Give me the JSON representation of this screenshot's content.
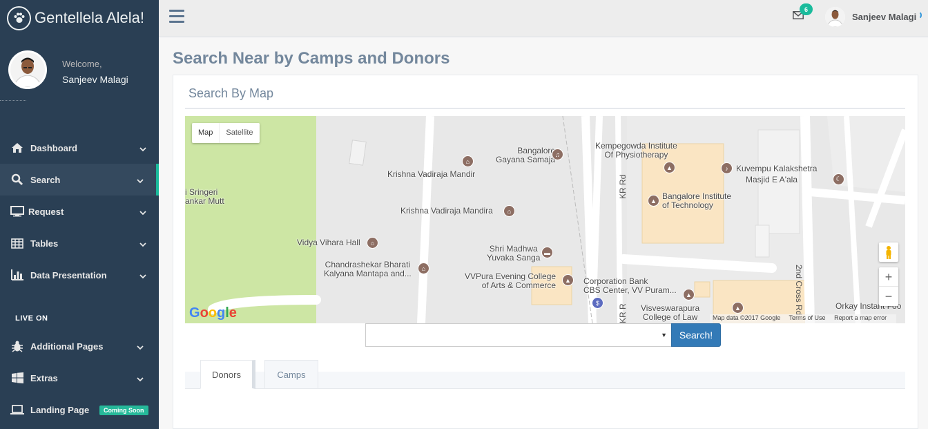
{
  "brand": {
    "title": "Gentellela Alela!",
    "icon": "paw-icon"
  },
  "profile": {
    "welcome": "Welcome,",
    "name": "Sanjeev Malagi"
  },
  "sidebar": {
    "items": [
      {
        "label": "Dashboard",
        "icon": "home-icon"
      },
      {
        "label": "Search",
        "icon": "search-icon"
      },
      {
        "label": "Request",
        "icon": "desktop-icon"
      },
      {
        "label": "Tables",
        "icon": "table-icon"
      },
      {
        "label": "Data Presentation",
        "icon": "bar-chart-icon"
      }
    ],
    "section_title": "LIVE ON",
    "items2": [
      {
        "label": "Additional Pages",
        "icon": "bug-icon"
      },
      {
        "label": "Extras",
        "icon": "windows-icon"
      },
      {
        "label": "Landing Page",
        "icon": "laptop-icon",
        "badge": "Coming Soon"
      }
    ]
  },
  "topnav": {
    "mail_count": "6",
    "user": "Sanjeev Malagi"
  },
  "page": {
    "title": "Search Near by Camps and Donors"
  },
  "panel": {
    "title": "Search By Map"
  },
  "map": {
    "type_map": "Map",
    "type_satellite": "Satellite",
    "google": "Google",
    "attribution": [
      "Map data ©2017 Google",
      "Terms of Use",
      "Report a map error"
    ],
    "places": {
      "gayana": "Bangalore\nGayana Samaja",
      "krishna1": "Krishna Vadiraja Mandir",
      "krishna2": "Krishna Vadiraja Mandira",
      "sringeri": "i Sringeri\nankar Mutt",
      "vidya": "Vidya Vihara Hall",
      "chandra": "Chandrashekar Bharati\nKalyana Mantapa and...",
      "madhwa": "Shri Madhwa\nYuvaka Sanga",
      "vvpura": "VVPura Evening College\nof Arts & Commerce",
      "kempe": "Kempegowda Institute\nOf Physiotherapy",
      "bit": "Bangalore Institute\nof Technology",
      "kuvempu": "Kuvempu Kalakshetra",
      "masjid": "Masjid E A'ala",
      "corp": "Corporation Bank\nCBS Center, VV Puram...",
      "visves": "Visveswarapura\nCollege of Law",
      "orkay": "Orkay Instant Foo",
      "kr_rd": "KR Rd",
      "kr_rd2": "KR R",
      "cross": "2nd Cross Rd"
    }
  },
  "search": {
    "button": "Search!"
  },
  "tabs": {
    "donors": "Donors",
    "camps": "Camps"
  }
}
